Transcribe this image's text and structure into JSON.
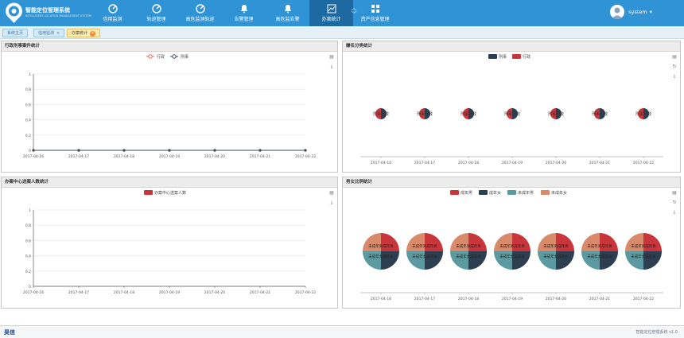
{
  "app": {
    "title": "智能定位管理系统",
    "subtitle": "INTELLIGENT LOCATION MANAGEMENT SYSTEM"
  },
  "nav": [
    {
      "label": "信用监测",
      "icon": "gauge-icon"
    },
    {
      "label": "轨迹管理",
      "icon": "gauge-icon"
    },
    {
      "label": "高危监测轨迹",
      "icon": "gauge-icon"
    },
    {
      "label": "告警管理",
      "icon": "bell-icon"
    },
    {
      "label": "高危监告警",
      "icon": "bell-icon"
    },
    {
      "label": "办案统计",
      "icon": "chart-icon",
      "active": true
    },
    {
      "label": "资产信息管理",
      "icon": "grid-icon"
    }
  ],
  "user": {
    "name": "system"
  },
  "tabs": [
    {
      "label": "系统主页"
    },
    {
      "label": "信用监测"
    },
    {
      "label": "办案统计",
      "active": true
    }
  ],
  "panels": {
    "p1": {
      "title": "行政刑事案件统计"
    },
    "p2": {
      "title": "嫌名分类统计"
    },
    "p3": {
      "title": "办案中心送案人数统计"
    },
    "p4": {
      "title": "男女比例统计"
    }
  },
  "footer": {
    "logo": "昊信",
    "text": "智能定位管理系统 v1.0"
  },
  "chart_data": [
    {
      "type": "line",
      "categories": [
        "2017-04-16",
        "2017-04-17",
        "2017-04-18",
        "2017-04-19",
        "2017-04-20",
        "2017-04-21",
        "2017-04-22"
      ],
      "series": [
        {
          "name": "行政",
          "values": [
            0,
            0,
            0,
            0,
            0,
            0,
            0
          ],
          "color": "#e8645a"
        },
        {
          "name": "刑事",
          "values": [
            0,
            0,
            0,
            0,
            0,
            0,
            0
          ],
          "color": "#3c4a5a"
        }
      ],
      "ylim": [
        0,
        1
      ],
      "yticks": [
        "0",
        "0.2",
        "0.4",
        "0.6",
        "0.8",
        "1"
      ],
      "grid": true,
      "legend": "top-center"
    },
    {
      "type": "pie",
      "categories": [
        "2017-04-16",
        "2017-04-17",
        "2017-04-18",
        "2017-04-19",
        "2017-04-20",
        "2017-04-21",
        "2017-04-22"
      ],
      "series": [
        {
          "name": "刑事",
          "value": 1,
          "color": "#2d3e50"
        },
        {
          "name": "行政",
          "value": 1,
          "color": "#c8353a"
        }
      ],
      "slice_label": "刑事行政",
      "legend": "top-center"
    },
    {
      "type": "bar",
      "categories": [
        "2017-04-16",
        "2017-04-17",
        "2017-04-18",
        "2017-04-19",
        "2017-04-20",
        "2017-04-21",
        "2017-04-22"
      ],
      "series": [
        {
          "name": "办案中心送案人数",
          "values": [
            0,
            0,
            0,
            0,
            0,
            0,
            0
          ],
          "color": "#c8353a"
        }
      ],
      "ylim": [
        0,
        1
      ],
      "yticks": [
        "0",
        "0.2",
        "0.4",
        "0.6",
        "0.8",
        "1"
      ],
      "grid": true,
      "legend": "top-center"
    },
    {
      "type": "pie",
      "categories": [
        "2017-04-16",
        "2017-04-17",
        "2017-04-18",
        "2017-04-19",
        "2017-04-20",
        "2017-04-21",
        "2017-04-22"
      ],
      "series": [
        {
          "name": "成年男",
          "value": 1,
          "color": "#c8353a"
        },
        {
          "name": "成年女",
          "value": 1,
          "color": "#2d3e50"
        },
        {
          "name": "未成年男",
          "value": 1,
          "color": "#5a9aa0"
        },
        {
          "name": "未成年女",
          "value": 1,
          "color": "#d88a6a"
        }
      ],
      "slice_labels": [
        "成年男",
        "成年女",
        "未成年男",
        "未成年女"
      ],
      "legend": "top-center"
    }
  ]
}
